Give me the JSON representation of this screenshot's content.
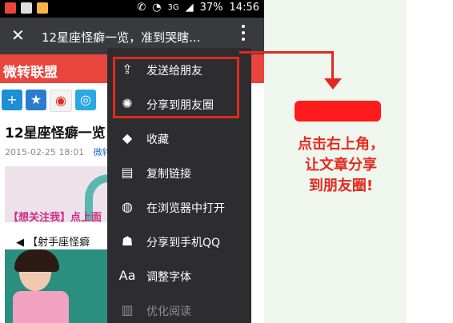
{
  "statusbar": {
    "sim_label": "3G",
    "battery": "37%",
    "time": "14:56"
  },
  "toolbar": {
    "title": "12星座怪癖一览，准到哭瞎..."
  },
  "page": {
    "banner": "微转联盟",
    "article_title": "12星座怪癖一览",
    "date": "2015-02-25 18:01",
    "author": "微转",
    "follow_text": "【想关注我】点上面",
    "sub_heading": "◀ 【射手座怪癖"
  },
  "menu": {
    "items": [
      {
        "label": "发送给朋友",
        "icon": "share-forward-icon"
      },
      {
        "label": "分享到朋友圈",
        "icon": "moments-aperture-icon"
      },
      {
        "label": "收藏",
        "icon": "favorite-box-icon"
      },
      {
        "label": "复制链接",
        "icon": "copy-link-icon"
      },
      {
        "label": "在浏览器中打开",
        "icon": "globe-icon"
      },
      {
        "label": "分享到手机QQ",
        "icon": "qq-penguin-icon"
      },
      {
        "label": "调整字体",
        "icon": "font-aa-icon"
      },
      {
        "label": "优化阅读",
        "icon": "book-icon"
      }
    ]
  },
  "annotation": {
    "instruction_lines": [
      "点击右上角，",
      "让文章分享",
      "到朋友圈!"
    ]
  },
  "colors": {
    "banner": "#e8463d",
    "toolbar": "#393a3e",
    "menu": "#2d2d2f",
    "highlight": "#e02a20"
  }
}
